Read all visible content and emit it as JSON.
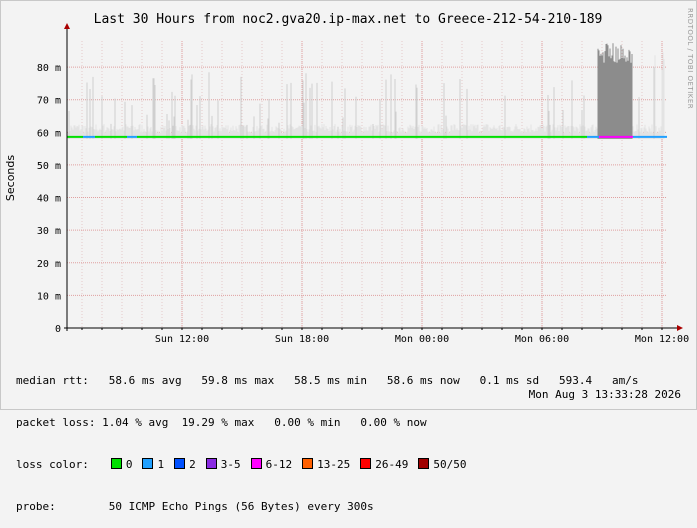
{
  "chart_data": {
    "type": "area",
    "title": "Last 30 Hours from noc2.gva20.ip-max.net to Greece-212-54-210-189",
    "ylabel": "Seconds",
    "xlabel": "",
    "ylim": [
      0,
      0.088
    ],
    "yticks": [
      {
        "value": 0,
        "label": "0"
      },
      {
        "value": 0.01,
        "label": "10 m"
      },
      {
        "value": 0.02,
        "label": "20 m"
      },
      {
        "value": 0.03,
        "label": "30 m"
      },
      {
        "value": 0.04,
        "label": "40 m"
      },
      {
        "value": 0.05,
        "label": "50 m"
      },
      {
        "value": 0.06,
        "label": "60 m"
      },
      {
        "value": 0.07,
        "label": "70 m"
      },
      {
        "value": 0.08,
        "label": "80 m"
      }
    ],
    "xrange_hours": [
      0,
      30
    ],
    "xticks": [
      {
        "hour": 5.75,
        "label": "Sun 12:00"
      },
      {
        "hour": 11.75,
        "label": "Sun 18:00"
      },
      {
        "hour": 17.75,
        "label": "Mon 00:00"
      },
      {
        "hour": 23.75,
        "label": "Mon 06:00"
      },
      {
        "hour": 29.75,
        "label": "Mon 12:00"
      }
    ],
    "median_ms": 58.6,
    "median_segments": [
      {
        "from_hour": 0.0,
        "to_hour": 0.8,
        "color": "#00e000"
      },
      {
        "from_hour": 0.8,
        "to_hour": 1.4,
        "color": "#20a0ff"
      },
      {
        "from_hour": 1.4,
        "to_hour": 3.0,
        "color": "#00e000"
      },
      {
        "from_hour": 3.0,
        "to_hour": 3.5,
        "color": "#20a0ff"
      },
      {
        "from_hour": 3.5,
        "to_hour": 26.0,
        "color": "#00e000"
      },
      {
        "from_hour": 26.0,
        "to_hour": 26.6,
        "color": "#20a0ff"
      },
      {
        "from_hour": 26.6,
        "to_hour": 28.3,
        "color": "#ff00ff"
      },
      {
        "from_hour": 28.3,
        "to_hour": 30.0,
        "color": "#20a0ff"
      }
    ],
    "grid": true
  },
  "legend": {
    "median_rtt": "median rtt:   58.6 ms avg   59.8 ms max   58.5 ms min   58.6 ms now   0.1 ms sd   593.4   am/s",
    "packet_loss": "packet loss: 1.04 % avg  19.29 % max   0.00 % min   0.00 % now",
    "loss_color_label": "loss color:",
    "loss_colors": [
      {
        "label": "0",
        "color": "#00e000"
      },
      {
        "label": "1",
        "color": "#20a0ff"
      },
      {
        "label": "2",
        "color": "#0050ff"
      },
      {
        "label": "3-5",
        "color": "#8a2be2"
      },
      {
        "label": "6-12",
        "color": "#ff00ff"
      },
      {
        "label": "13-25",
        "color": "#ff6000"
      },
      {
        "label": "26-49",
        "color": "#ff0000"
      },
      {
        "label": "50/50",
        "color": "#a00000"
      }
    ],
    "probe": "probe:        50 ICMP Echo Pings (56 Bytes) every 300s",
    "date": "Mon Aug  3 13:33:28 2026"
  },
  "watermark": "RRDTOOL / TOBI OETIKER"
}
